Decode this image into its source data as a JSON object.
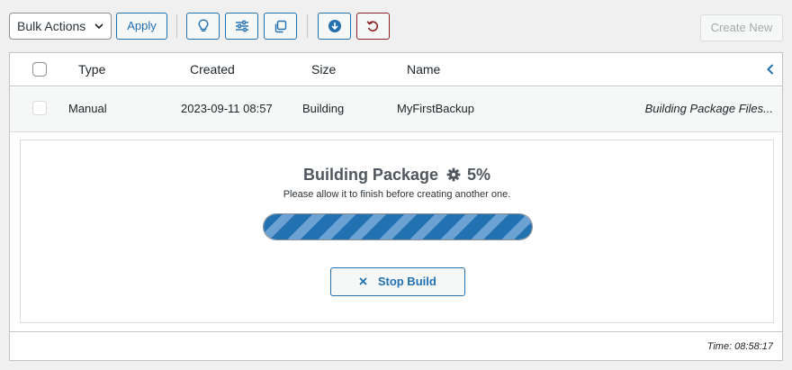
{
  "toolbar": {
    "bulk_actions": {
      "selected": "Bulk Actions",
      "icon": "chevron-down-icon"
    },
    "apply_label": "Apply",
    "icon_buttons": [
      {
        "icon": "lightbulb-icon"
      },
      {
        "icon": "sliders-icon"
      },
      {
        "icon": "copy-icon"
      },
      {
        "icon": "download-circle-icon"
      },
      {
        "icon": "undo-icon",
        "color": "#8a2424"
      }
    ],
    "create_new_label": "Create New"
  },
  "table": {
    "columns": [
      "Type",
      "Created",
      "Size",
      "Name"
    ],
    "collapse_icon": "chevron-left-icon",
    "rows": [
      {
        "type": "Manual",
        "created": "2023-09-11 08:57",
        "size": "Building",
        "name": "MyFirstBackup",
        "status": "Building Package Files..."
      }
    ]
  },
  "progress": {
    "title": "Building Package",
    "title_icon": "gear-icon",
    "percent_label": "5%",
    "subtitle": "Please allow it to finish before creating another one.",
    "fill_fraction": 1.0,
    "stop_icon": "close-icon",
    "stop_label": "Stop Build"
  },
  "footer": {
    "time_label": "Time: 08:58:17"
  },
  "colors": {
    "accent": "#2271b1",
    "danger": "#8a2424",
    "disabled": "#a7aaad"
  }
}
